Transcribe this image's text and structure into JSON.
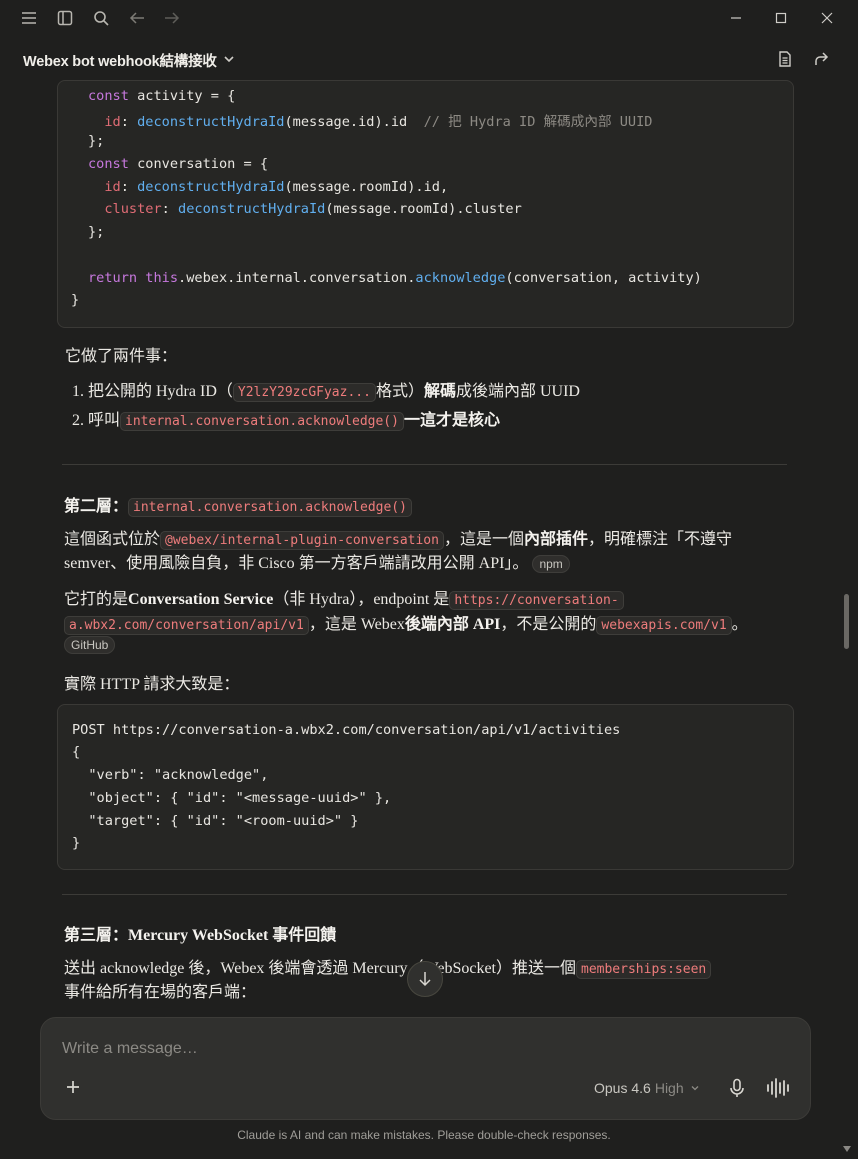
{
  "window": {
    "icons": [
      "menu-icon",
      "sidebar-icon",
      "search-icon",
      "back-icon",
      "forward-icon",
      "minimize-icon",
      "maximize-icon",
      "close-icon"
    ]
  },
  "header": {
    "title": "Webex bot webhook結構接收",
    "icons": [
      "chevron-down-icon",
      "document-icon",
      "share-icon"
    ]
  },
  "code1": {
    "lines": [
      "const activity = {",
      "  id: deconstructHydraId(message.id).id  // 把 Hydra ID 解碼成內部 UUID",
      "};",
      "const conversation = {",
      "  id: deconstructHydraId(message.roomId).id,",
      "  cluster: deconstructHydraId(message.roomId).cluster",
      "};",
      "",
      "return this.webex.internal.conversation.acknowledge(conversation, activity)",
      "}"
    ]
  },
  "section1": {
    "intro": "它做了兩件事：",
    "item1_num": "1.",
    "item1_a": "把公開的 Hydra ID（",
    "item1_code": "Y2lzY29zcGFyaz...",
    "item1_b": "格式）",
    "item1_bold": "解碼",
    "item1_c": "成後端內部 UUID",
    "item2_num": "2.",
    "item2_a": "呼叫",
    "item2_code": "internal.conversation.acknowledge()",
    "item2_bold": "一這才是核心"
  },
  "section2": {
    "heading": "第二層：",
    "heading_code": "internal.conversation.acknowledge()",
    "p1_a": "這個函式位於",
    "p1_code": "@webex/internal-plugin-conversation",
    "p1_b": "，這是一個",
    "p1_bold": "內部插件",
    "p1_c": "，明確標注「不遵守",
    "p1_line2": "semver、使用風險自負，非 Cisco 第一方客戶端請改用公開 API」。",
    "p1_badge": "npm",
    "p2_a": "它打的是",
    "p2_bold1": "Conversation Service",
    "p2_b": "（非 Hydra），endpoint 是",
    "p2_code1a": "https://conversation-",
    "p2_code1b": "a.wbx2.com/conversation/api/v1",
    "p2_c": "，這是 Webex",
    "p2_bold2": "後端內部 API",
    "p2_d": "，不是公開的",
    "p2_code2": "webexapis.com/v1",
    "p2_e": "。",
    "p2_badge": "GitHub",
    "p3": "實際 HTTP 請求大致是："
  },
  "code2": {
    "lines": [
      "POST https://conversation-a.wbx2.com/conversation/api/v1/activities",
      "{",
      "  \"verb\": \"acknowledge\",",
      "  \"object\": { \"id\": \"<message-uuid>\" },",
      "  \"target\": { \"id\": \"<room-uuid>\" }",
      "}"
    ]
  },
  "section3": {
    "heading": "第三層：Mercury WebSocket 事件回饋",
    "p1_a": "送出 acknowledge 後，Webex 後端會透過 Mercury（WebSocket）推送一個",
    "p1_code": "memberships:seen",
    "p1_line2": "事件給所有在場的客戶端："
  },
  "composer": {
    "placeholder": "Write a message…",
    "model": "Opus 4.6",
    "effort": "High",
    "disclaimer": "Claude is AI and can make mistakes. Please double-check responses."
  }
}
